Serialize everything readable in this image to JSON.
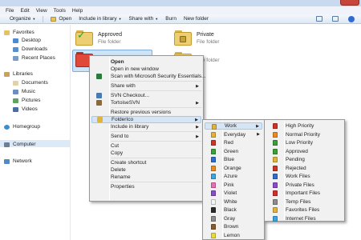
{
  "window": {
    "close_glyph": "✕"
  },
  "menubar": [
    "File",
    "Edit",
    "View",
    "Tools",
    "Help"
  ],
  "toolbar": {
    "organize": "Organize",
    "open": "Open",
    "include": "Include in library",
    "share": "Share with",
    "burn": "Burn",
    "new_folder": "New folder"
  },
  "nav": {
    "favorites": "Favorites",
    "desktop": "Desktop",
    "downloads": "Downloads",
    "recent": "Recent Places",
    "libraries": "Libraries",
    "documents": "Documents",
    "music": "Music",
    "pictures": "Pictures",
    "videos": "Videos",
    "homegroup": "Homegroup",
    "computer": "Computer",
    "network": "Network"
  },
  "files": [
    {
      "name": "Approved",
      "type": "File folder"
    },
    {
      "name": "Private",
      "type": "File folder"
    },
    {
      "name": "",
      "type": "File folder"
    }
  ],
  "context_menu": [
    {
      "label": "Open",
      "bold": true
    },
    {
      "label": "Open in new window"
    },
    {
      "label": "Scan with Microsoft Security Essentials..."
    },
    {
      "sep": true
    },
    {
      "label": "Share with",
      "sub": true
    },
    {
      "sep": true
    },
    {
      "label": "SVN Checkout..."
    },
    {
      "label": "TortoiseSVN",
      "sub": true
    },
    {
      "sep": true
    },
    {
      "label": "Restore previous versions"
    },
    {
      "label": "FolderIco",
      "sub": true,
      "highlight": true
    },
    {
      "label": "Include in library",
      "sub": true
    },
    {
      "sep": true
    },
    {
      "label": "Send to",
      "sub": true
    },
    {
      "sep": true
    },
    {
      "label": "Cut"
    },
    {
      "label": "Copy"
    },
    {
      "sep": true
    },
    {
      "label": "Create shortcut"
    },
    {
      "label": "Delete"
    },
    {
      "label": "Rename"
    },
    {
      "sep": true
    },
    {
      "label": "Properties"
    }
  ],
  "folderico_menu": [
    {
      "label": "Work",
      "sub": true,
      "highlight": true,
      "color": "#e0b43a"
    },
    {
      "label": "Everyday",
      "sub": true,
      "color": "#e0b43a"
    },
    {
      "label": "Red",
      "color": "#d03228"
    },
    {
      "label": "Green",
      "color": "#3aa13a"
    },
    {
      "label": "Blue",
      "color": "#2f6cd1"
    },
    {
      "label": "Orange",
      "color": "#ee8a1c"
    },
    {
      "label": "Azure",
      "color": "#3aa5e0"
    },
    {
      "label": "Pink",
      "color": "#e86fb0"
    },
    {
      "label": "Violet",
      "color": "#8a4cc9"
    },
    {
      "label": "White",
      "color": "#f4f4f4"
    },
    {
      "label": "Black",
      "color": "#2b2b2b"
    },
    {
      "label": "Gray",
      "color": "#8c8c8c"
    },
    {
      "label": "Brown",
      "color": "#8a5a2b"
    },
    {
      "label": "Lemon",
      "color": "#e8dc3a"
    }
  ],
  "work_menu": [
    {
      "label": "High Priority",
      "color": "#d03228"
    },
    {
      "label": "Normal Priority",
      "color": "#ee8a1c"
    },
    {
      "label": "Low Priority",
      "color": "#3aa13a"
    },
    {
      "label": "Approved",
      "color": "#3aa13a"
    },
    {
      "label": "Pending",
      "color": "#e0b43a"
    },
    {
      "label": "Rejected",
      "color": "#d03228"
    },
    {
      "label": "Work Files",
      "color": "#2f6cd1"
    },
    {
      "label": "Private Files",
      "color": "#8a4cc9"
    },
    {
      "label": "Important Files",
      "color": "#d03228"
    },
    {
      "label": "Temp Files",
      "color": "#8c8c8c"
    },
    {
      "label": "Favorites Files",
      "color": "#e0b43a"
    },
    {
      "label": "Internet Files",
      "color": "#3aa5e0"
    }
  ]
}
